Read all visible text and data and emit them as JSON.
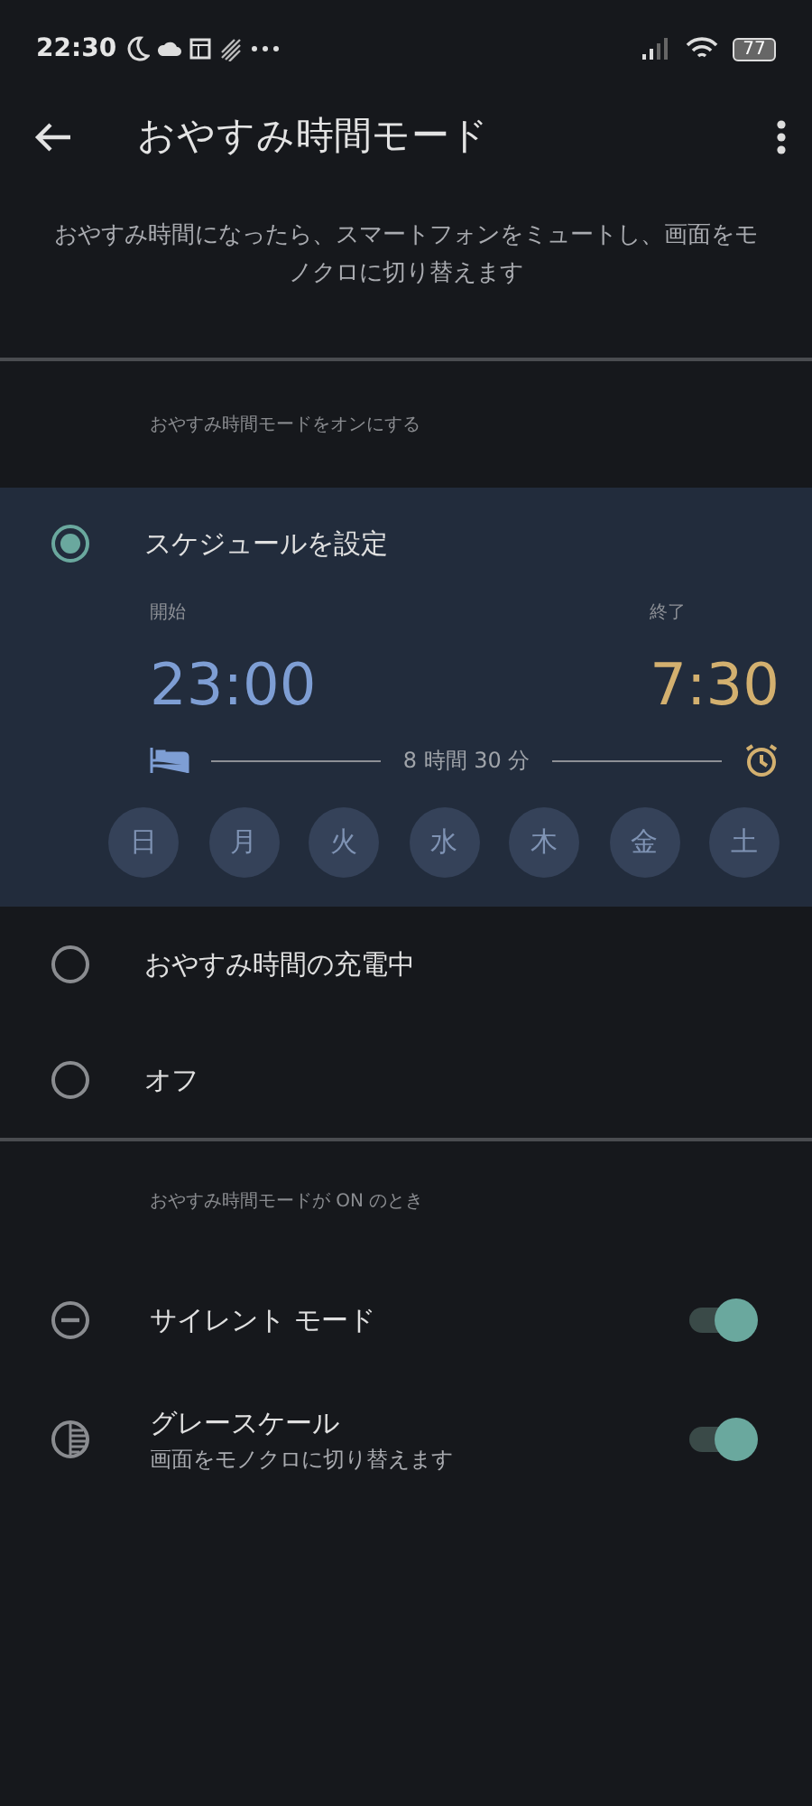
{
  "status_bar": {
    "time": "22:30",
    "battery": "77"
  },
  "header": {
    "title": "おやすみ時間モード"
  },
  "description": "おやすみ時間になったら、スマートフォンをミュートし、画面をモノクロに切り替えます",
  "mode_section": {
    "label": "おやすみ時間モードをオンにする",
    "options": [
      {
        "label": "スケジュールを設定",
        "selected": true,
        "schedule": {
          "start_label": "開始",
          "start": "23:00",
          "end_label": "終了",
          "end": "7:30",
          "duration": "8 時間 30 分",
          "days": [
            {
              "label": "日",
              "selected": false
            },
            {
              "label": "月",
              "selected": false
            },
            {
              "label": "火",
              "selected": false
            },
            {
              "label": "水",
              "selected": false
            },
            {
              "label": "木",
              "selected": false
            },
            {
              "label": "金",
              "selected": false
            },
            {
              "label": "土",
              "selected": false
            }
          ]
        }
      },
      {
        "label": "おやすみ時間の充電中",
        "selected": false
      },
      {
        "label": "オフ",
        "selected": false
      }
    ]
  },
  "when_on_section": {
    "label": "おやすみ時間モードが ON のとき",
    "settings": [
      {
        "kind": "silent",
        "title": "サイレント モード",
        "on": true
      },
      {
        "kind": "grayscale",
        "title": "グレースケール",
        "subtitle": "画面をモノクロに切り替えます",
        "on": true
      }
    ]
  }
}
